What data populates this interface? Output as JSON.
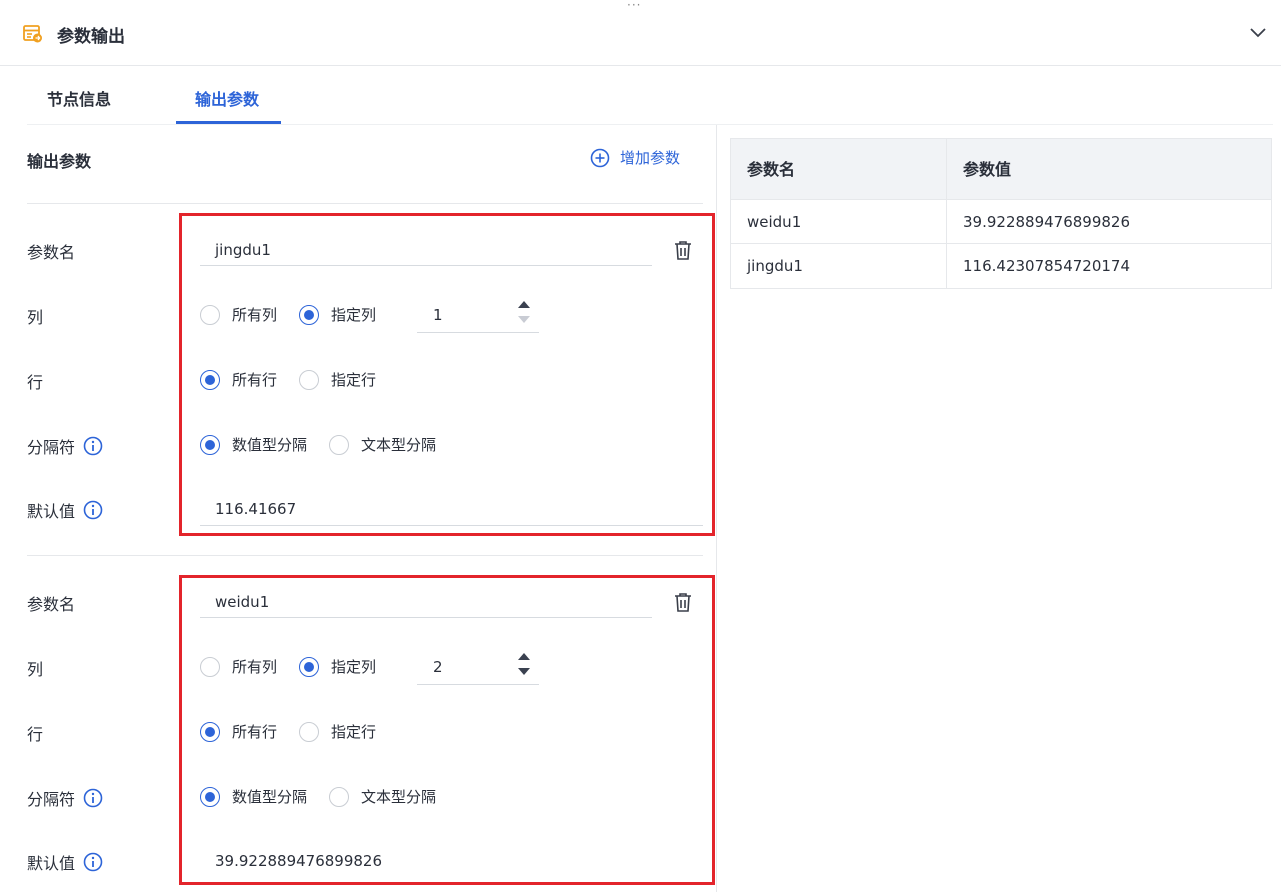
{
  "header": {
    "title": "参数输出",
    "dots": "···"
  },
  "tabs": [
    {
      "label": "节点信息"
    },
    {
      "label": "输出参数"
    }
  ],
  "section": {
    "title": "输出参数",
    "add_label": "增加参数"
  },
  "labels": {
    "param_name": "参数名",
    "column": "列",
    "row": "行",
    "separator": "分隔符",
    "default": "默认值",
    "all_columns": "所有列",
    "specific_column": "指定列",
    "all_rows": "所有行",
    "specific_row": "指定行",
    "numeric_sep": "数值型分隔",
    "text_sep": "文本型分隔"
  },
  "params": [
    {
      "name": "jingdu1",
      "column_mode": "specific",
      "column_value": "1",
      "row_mode": "all",
      "separator": "numeric",
      "default": "116.41667"
    },
    {
      "name": "weidu1",
      "column_mode": "specific",
      "column_value": "2",
      "row_mode": "all",
      "separator": "numeric",
      "default": "39.922889476899826"
    }
  ],
  "table": {
    "headers": [
      "参数名",
      "参数值"
    ],
    "rows": [
      [
        "weidu1",
        "39.922889476899826"
      ],
      [
        "jingdu1",
        "116.42307854720174"
      ]
    ]
  },
  "colors": {
    "accent": "#2d64d8",
    "highlight": "#e3242b",
    "header_icon": "#f0a020"
  }
}
